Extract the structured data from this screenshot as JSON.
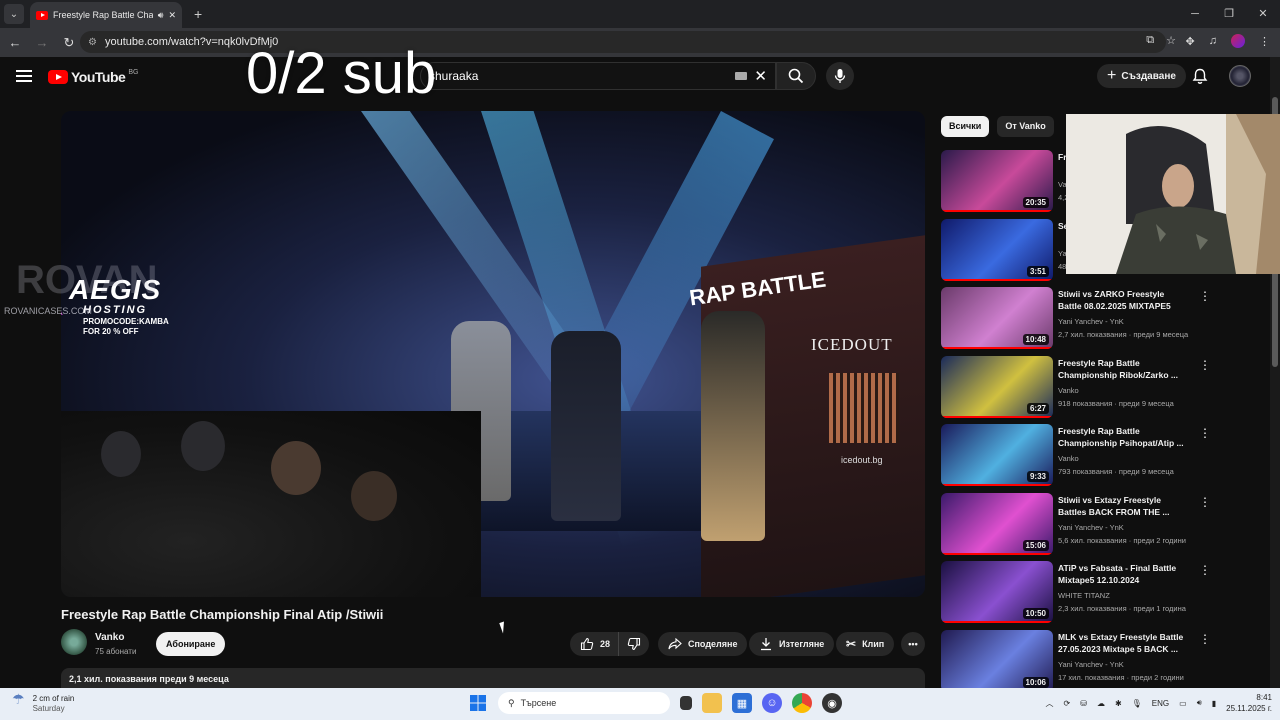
{
  "browser": {
    "tab_title": "Freestyle Rap Battle Championship Final Atip /Stiwii",
    "url": "youtube.com/watch?v=nqk0lvDfMj0"
  },
  "header": {
    "logo_text": "YouTube",
    "country_code": "BG",
    "search_value": "shuraaka",
    "create_label": "Създаване"
  },
  "overlay": {
    "sub_goal": "0/2 sub",
    "rovan_text": "ROVAN",
    "rovan_url": "ROVANICASES.COM",
    "aegis_title": "AEGIS",
    "aegis_sub": "HOSTING",
    "aegis_promo1": "PROMOCODE:KAMBA",
    "aegis_promo2": "FOR 20 % OFF"
  },
  "video_scene": {
    "rap_battle": "RAP BATTLE",
    "icedout": "ICEDOUT",
    "icedout_url": "icedout.bg"
  },
  "video": {
    "title": "Freestyle Rap Battle Championship Final Atip /Stiwii",
    "channel": "Vanko",
    "subscribers": "75 абонати",
    "subscribe_label": "Абониране",
    "likes": "28",
    "share_label": "Споделяне",
    "download_label": "Изтегляне",
    "clip_label": "Клип",
    "views_date": "2,1 хил. показвания  преди 9 месеца"
  },
  "chips": [
    "Всички",
    "От Vanko"
  ],
  "recommendations": [
    {
      "title": "Fr... Ch...",
      "channel": "Van...",
      "meta": "4,2...",
      "duration": "20:35",
      "colors": [
        "#2a1a4a",
        "#c84a9a"
      ]
    },
    {
      "title": "Se... M...",
      "channel": "Ya...",
      "meta": "48...",
      "duration": "3:51",
      "colors": [
        "#101a6a",
        "#3a6ae0"
      ]
    },
    {
      "title": "Stiwii vs ZARKO Freestyle Battle 08.02.2025 MIXTAPE5",
      "channel": "Yani Yanchev - YnK",
      "meta": "2,7 хил. показвания · преди 9 месеца",
      "duration": "10:48",
      "colors": [
        "#6a3a6a",
        "#d080d0"
      ]
    },
    {
      "title": "Freestyle Rap Battle Championship Ribok/Zarko ...",
      "channel": "Vanko",
      "meta": "918 показвания · преди 9 месеца",
      "duration": "6:27",
      "colors": [
        "#1a2a5a",
        "#d0c040"
      ]
    },
    {
      "title": "Freestyle Rap Battle Championship Psihopat/Atip ...",
      "channel": "Vanko",
      "meta": "793 показвания · преди 9 месеца",
      "duration": "9:33",
      "colors": [
        "#1a1a5a",
        "#50b0e0"
      ]
    },
    {
      "title": "Stiwii vs Extazy Freestyle Battles BACK FROM THE ...",
      "channel": "Yani Yanchev - YnK",
      "meta": "5,6 хил. показвания · преди 2 години",
      "duration": "15:06",
      "colors": [
        "#3a1a6a",
        "#e050d0"
      ]
    },
    {
      "title": "ATiP vs Fabsata - Final Battle Mixtape5 12.10.2024",
      "channel": "WHITE TITANZ",
      "meta": "2,3 хил. показвания · преди 1 година",
      "duration": "10:50",
      "colors": [
        "#1a1040",
        "#8a50d0"
      ]
    },
    {
      "title": "MLK vs Extazy Freestyle Battle 27.05.2023 Mixtape 5 BACK ...",
      "channel": "Yani Yanchev - YnK",
      "meta": "17 хил. показвания · преди 2 години",
      "duration": "10:06",
      "colors": [
        "#201a50",
        "#6a80e0"
      ]
    }
  ],
  "taskbar": {
    "weather_main": "2 cm of rain",
    "weather_sub": "Saturday",
    "search_placeholder": "Търсене",
    "lang": "ENG",
    "time": "8:41",
    "date": "25.11.2025 г."
  },
  "colors": {
    "accent": "#ff0000",
    "background": "#0f0f0f"
  }
}
